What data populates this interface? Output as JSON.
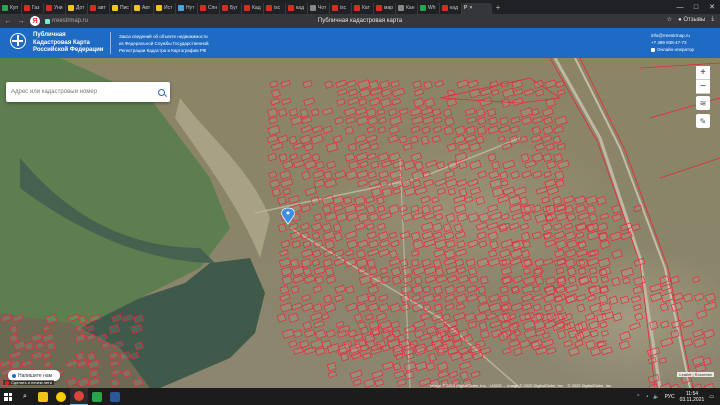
{
  "browser": {
    "tabs": [
      {
        "label": "Куп",
        "color": "#2ba24c"
      },
      {
        "label": "Газ",
        "color": "#d62d20"
      },
      {
        "label": "Уни",
        "color": "#d62d20"
      },
      {
        "label": "Дот",
        "color": "#f0c419"
      },
      {
        "label": "авт",
        "color": "#d62d20"
      },
      {
        "label": "Пис",
        "color": "#f0c419"
      },
      {
        "label": "Авт",
        "color": "#f0c419"
      },
      {
        "label": "Ист",
        "color": "#f0c419"
      },
      {
        "label": "Нут",
        "color": "#4aa3df"
      },
      {
        "label": "Спн",
        "color": "#d62d20"
      },
      {
        "label": "Буг",
        "color": "#d62d20"
      },
      {
        "label": "Кад",
        "color": "#d62d20"
      },
      {
        "label": "isc",
        "color": "#d62d20"
      },
      {
        "label": "кад",
        "color": "#d62d20"
      },
      {
        "label": "Чот",
        "color": "#888888"
      },
      {
        "label": "isc",
        "color": "#d62d20"
      },
      {
        "label": "Кат",
        "color": "#d62d20"
      },
      {
        "label": "мар",
        "color": "#d62d20"
      },
      {
        "label": "Кан",
        "color": "#888888"
      },
      {
        "label": "Wh",
        "color": "#2ba24c"
      },
      {
        "label": "кад",
        "color": "#d62d20"
      }
    ],
    "active_tab": {
      "label": "Р",
      "close": "×"
    },
    "new_tab": "+",
    "window_controls": [
      "—",
      "□",
      "✕"
    ],
    "url": "rreestrmap.ru",
    "page_title": "Публичная кадастровая карта",
    "reviews_label": "Отзывы"
  },
  "header": {
    "brand_lines": [
      "Публичная",
      "Кадастровая Карта",
      "Российской Федерации"
    ],
    "info_lines": [
      "Заказ сведений об объекте недвижимости",
      "из Федеральной Службы Государственной",
      "Регистрации Кадастра и Картографии РФ"
    ],
    "email": "info@rreestrmap.ru",
    "phone": "+7 499 938-47-72",
    "online_operator": "Онлайн-оператор"
  },
  "map": {
    "search_placeholder": "Адрес или кадастровый номер",
    "zoom_in": "+",
    "zoom_out": "−",
    "attribution": "Image © 2019 DigitalGlobe, Inc. · USGS ... Image © 2020 DigitalGlobe, Inc. · © 2020 DigitalGlobe, Inc.",
    "leaflet_credit": "Leaflet | Rosreestr",
    "parcel_color": "#e8283a",
    "water_color": "#3f5a4b"
  },
  "chat": {
    "title": "Напишите нам",
    "subtitle": "Сделать и нечем нети"
  },
  "taskbar": {
    "apps": [
      {
        "name": "file-explorer-icon",
        "color": "#f0c419"
      },
      {
        "name": "yandex-browser-icon",
        "color": "#ffcc00"
      },
      {
        "name": "chrome-icon",
        "color": "#db4437"
      },
      {
        "name": "app-icon",
        "color": "#2ba24c"
      },
      {
        "name": "word-icon",
        "color": "#2b579a"
      }
    ],
    "language": "РУС",
    "time": "11:54",
    "date": "03.11.2021"
  }
}
